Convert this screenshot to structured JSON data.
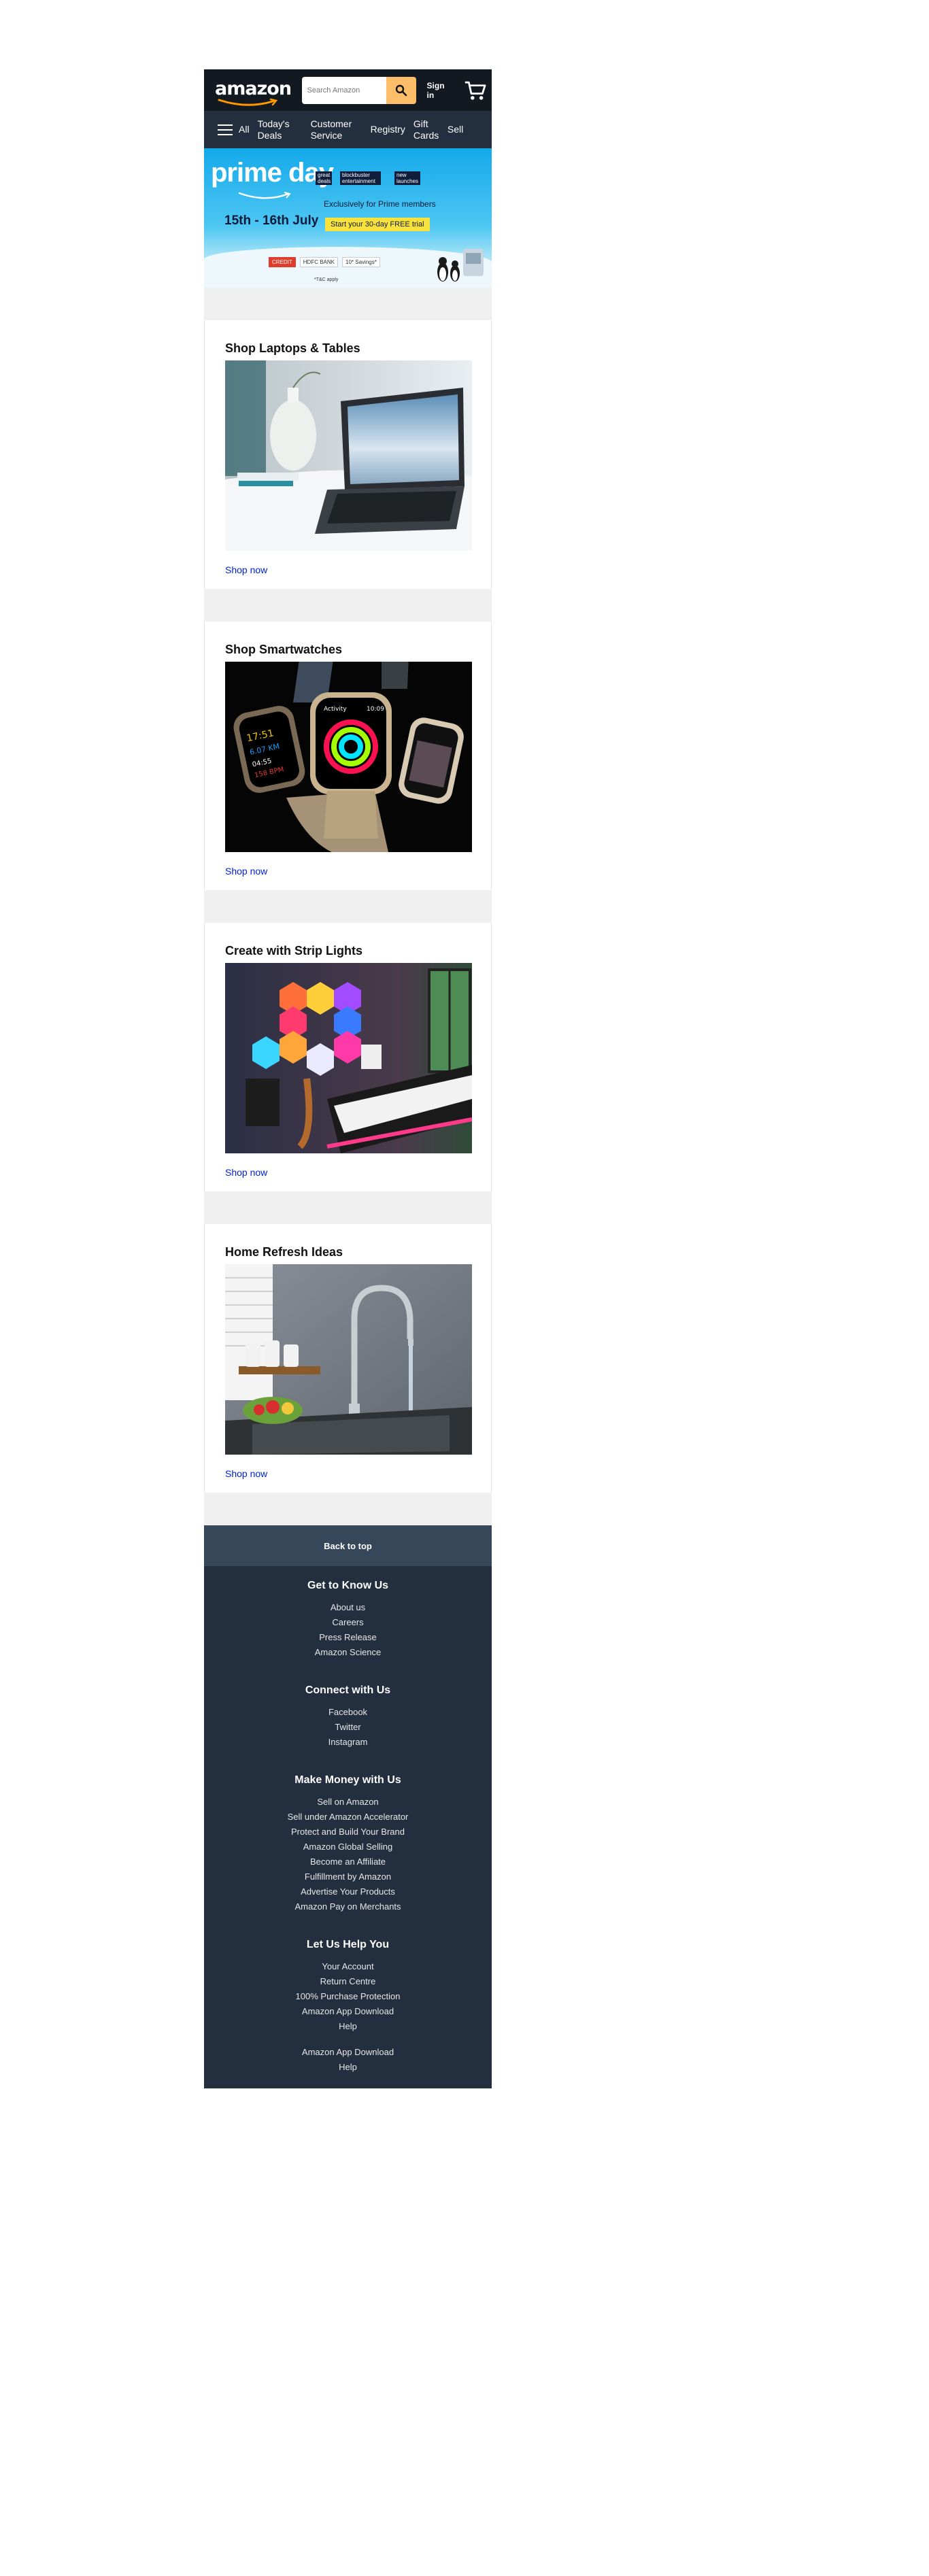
{
  "header": {
    "logo_text": "amazon",
    "search_placeholder": "Search Amazon",
    "signin_label": "Sign in"
  },
  "nav": {
    "items": [
      {
        "label": "All"
      },
      {
        "label": "Today's Deals"
      },
      {
        "label": "Customer Service"
      },
      {
        "label": "Registry"
      },
      {
        "label": "Gift Cards"
      },
      {
        "label": "Sell"
      }
    ]
  },
  "banner": {
    "title": "prime day",
    "dates": "15th - 16th July",
    "tags": [
      "great deals",
      "blockbuster entertainment",
      "new launches"
    ],
    "exclusive": "Exclusively for Prime members",
    "trial": "Start your 30-day FREE trial",
    "offer_badges": [
      "CREDIT",
      "HDFC BANK",
      "10* Savings*"
    ],
    "offer_note": "*T&C apply"
  },
  "cards": [
    {
      "title": "Shop Laptops & Tables",
      "link": "Shop now",
      "image_alt": "laptop on white table with vase"
    },
    {
      "title": "Shop Smartwatches",
      "link": "Shop now",
      "image_alt": "three smartwatches"
    },
    {
      "title": "Create with Strip Lights",
      "link": "Shop now",
      "image_alt": "music room with light panels"
    },
    {
      "title": "Home Refresh Ideas",
      "link": "Shop now",
      "image_alt": "kitchen faucet and sink"
    }
  ],
  "footer": {
    "back_to_top": "Back to top",
    "columns": [
      {
        "heading": "Get to Know Us",
        "links": [
          "About us",
          "Careers",
          "Press Release",
          "Amazon Science"
        ]
      },
      {
        "heading": "Connect with Us",
        "links": [
          "Facebook",
          "Twitter",
          "Instagram"
        ]
      },
      {
        "heading": "Make Money with Us",
        "links": [
          "Sell on Amazon",
          "Sell under Amazon Accelerator",
          "Protect and Build Your Brand",
          "Amazon Global Selling",
          "Become an Affiliate",
          "Fulfillment by Amazon",
          "Advertise Your Products",
          "Amazon Pay on Merchants"
        ]
      },
      {
        "heading": "Let Us Help You",
        "links": [
          "Your Account",
          "Return Centre",
          "100% Purchase Protection",
          "Amazon App Download",
          "Help"
        ]
      }
    ],
    "extra_links": [
      "Amazon App Download",
      "Help"
    ]
  },
  "colors": {
    "topbar": "#131921",
    "navbar": "#232f3e",
    "search_button": "#febd69",
    "link": "#0021d8",
    "back_to_top": "#37475a",
    "footer": "#232f3e"
  },
  "icons": [
    "search-icon",
    "cart-icon",
    "hamburger-icon"
  ]
}
